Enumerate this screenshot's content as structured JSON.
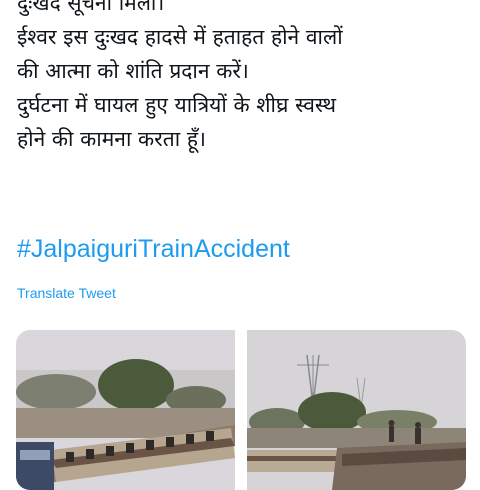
{
  "tweet": {
    "text_lines": [
      "दुःखद सूचना मिली।",
      "ईश्वर इस दुःखद हादसे में हताहत होने वालों",
      "की आत्मा को शांति प्रदान करें।",
      "दुर्घटना में घायल हुए यात्रियों के शीघ्र स्वस्थ",
      "होने की कामना करता हूँ।"
    ],
    "hashtag": "#JalpaiguriTrainAccident",
    "translate_label": "Translate Tweet"
  },
  "media": {
    "photos": [
      {
        "name": "train-accident-photo-1"
      },
      {
        "name": "train-accident-photo-2"
      }
    ],
    "colors": {
      "sky": "#d8d6da",
      "foliage": "#4a5a3a",
      "coach_body": "#9c8a78",
      "coach_stripe": "#6a5446"
    }
  }
}
